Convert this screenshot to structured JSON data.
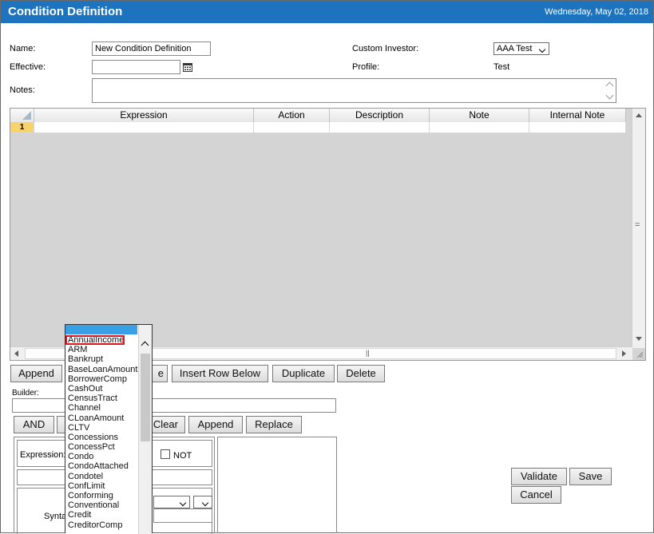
{
  "header": {
    "title": "Condition Definition",
    "date": "Wednesday, May 02, 2018"
  },
  "form": {
    "name_label": "Name:",
    "name_value": "New Condition Definition",
    "effective_label": "Effective:",
    "effective_value": "",
    "notes_label": "Notes:",
    "notes_value": "",
    "custom_investor_label": "Custom Investor:",
    "custom_investor_value": "AAA Test",
    "profile_label": "Profile:",
    "profile_value": "Test"
  },
  "grid": {
    "columns": [
      "Expression",
      "Action",
      "Description",
      "Note",
      "Internal Note"
    ],
    "rows": [
      {
        "num": "1",
        "cells": [
          "",
          "",
          "",
          "",
          ""
        ]
      }
    ],
    "hscroll_glyph": "||",
    "vscroll_glyph": "="
  },
  "row_buttons": {
    "append": "Append",
    "insert_above_partial": "e",
    "insert_below": "Insert Row Below",
    "duplicate": "Duplicate",
    "delete": "Delete"
  },
  "builder": {
    "label": "Builder:",
    "value": "",
    "and": "AND",
    "clear": "Clear",
    "append": "Append",
    "replace": "Replace",
    "expression_label": "Expression:",
    "not_label": "NOT",
    "syntax_partial": "Synta"
  },
  "actions": {
    "validate": "Validate",
    "save": "Save",
    "cancel": "Cancel"
  },
  "dropdown": {
    "highlighted": "AnnualIncome",
    "items": [
      "AnnualIncome",
      "ARM",
      "Bankrupt",
      "BaseLoanAmount",
      "BorrowerComp",
      "CashOut",
      "CensusTract",
      "Channel",
      "CLoanAmount",
      "CLTV",
      "Concessions",
      "ConcessPct",
      "Condo",
      "CondoAttached",
      "Condotel",
      "ConfLimit",
      "Conforming",
      "Conventional",
      "Credit",
      "CreditorComp"
    ]
  },
  "icons": {
    "calendar": "calendar-icon",
    "chevron": "chevron-down-icon"
  }
}
